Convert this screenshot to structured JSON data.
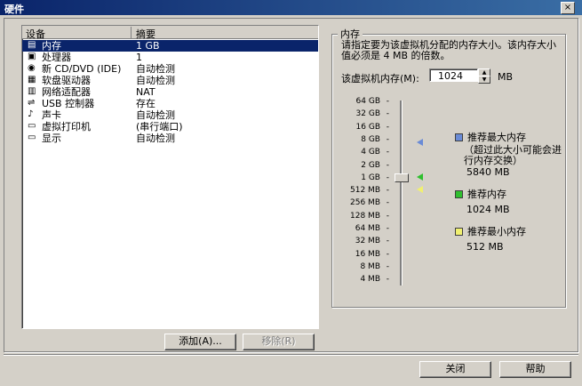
{
  "window": {
    "title": "硬件",
    "close_glyph": "×"
  },
  "device_list": {
    "headers": {
      "device": "设备",
      "summary": "摘要"
    },
    "items": [
      {
        "name": "内存",
        "summary": "1 GB",
        "icon": "memory-icon",
        "selected": true
      },
      {
        "name": "处理器",
        "summary": "1",
        "icon": "cpu-icon"
      },
      {
        "name": "新 CD/DVD (IDE)",
        "summary": "自动检测",
        "icon": "cd-icon"
      },
      {
        "name": "软盘驱动器",
        "summary": "自动检测",
        "icon": "floppy-icon"
      },
      {
        "name": "网络适配器",
        "summary": "NAT",
        "icon": "network-icon"
      },
      {
        "name": "USB 控制器",
        "summary": "存在",
        "icon": "usb-icon"
      },
      {
        "name": "声卡",
        "summary": "自动检测",
        "icon": "sound-icon"
      },
      {
        "name": "虚拟打印机",
        "summary": "(串行端口)",
        "icon": "printer-icon"
      },
      {
        "name": "显示",
        "summary": "自动检测",
        "icon": "monitor-icon"
      }
    ],
    "add_button": "添加(A)...",
    "remove_button": "移除(R)"
  },
  "memory": {
    "group_title": "内存",
    "description": "请指定要为该虚拟机分配的内存大小。该内存大小值必须是 4 MB 的倍数。",
    "label": "该虚拟机内存(M):",
    "value": "1024",
    "unit": "MB",
    "ticks": [
      "64 GB",
      "32 GB",
      "16 GB",
      "8 GB",
      "4 GB",
      "2 GB",
      "1 GB",
      "512 MB",
      "256 MB",
      "128 MB",
      "64 MB",
      "32 MB",
      "16 MB",
      "8 MB",
      "4 MB"
    ],
    "slider_value": "1 GB",
    "legend": {
      "max": {
        "title": "推荐最大内存",
        "note": "（超过此大小可能会进行内存交换）",
        "value": "5840 MB",
        "color": "#6a8bd6"
      },
      "recommended": {
        "title": "推荐内存",
        "value": "1024 MB",
        "color": "#2fbf2f"
      },
      "min": {
        "title": "推荐最小内存",
        "value": "512 MB",
        "color": "#f0f070"
      }
    }
  },
  "footer": {
    "close_button": "关闭",
    "help_button": "帮助"
  }
}
